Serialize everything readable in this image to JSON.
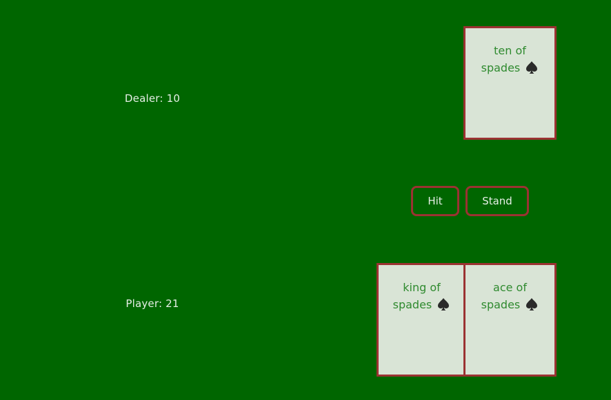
{
  "dealer": {
    "score_label": "Dealer: 10",
    "cards": [
      {
        "name": "ten of spades",
        "line1": "ten of",
        "line2": "spades",
        "suit_icon": "spade-icon"
      }
    ]
  },
  "player": {
    "score_label": "Player: 21",
    "cards": [
      {
        "name": "king of spades",
        "line1": "king of",
        "line2": "spades",
        "suit_icon": "spade-icon"
      },
      {
        "name": "ace of spades",
        "line1": "ace of",
        "line2": "spades",
        "suit_icon": "spade-icon"
      }
    ]
  },
  "controls": {
    "hit_label": "Hit",
    "stand_label": "Stand"
  },
  "colors": {
    "table": "#006600",
    "card_face": "#d9e4d6",
    "card_border": "#9b3232",
    "card_text": "#2f8a2f",
    "label_text": "#e6efe6"
  }
}
